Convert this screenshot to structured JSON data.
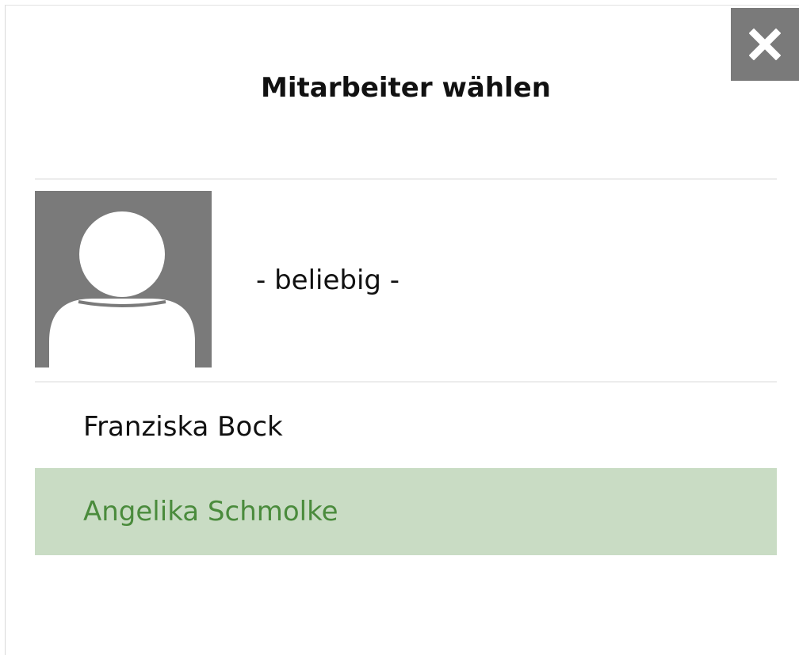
{
  "dialog": {
    "title": "Mitarbeiter wählen",
    "close_icon": "close-icon"
  },
  "options": {
    "any": {
      "label": "- beliebig -",
      "avatar_icon": "person-placeholder-icon"
    },
    "employees": [
      {
        "name": "Franziska Bock",
        "selected": false
      },
      {
        "name": "Angelika Schmolke",
        "selected": true
      }
    ]
  },
  "colors": {
    "selected_background": "#c9dcc4",
    "selected_text": "#4a8b3c",
    "close_button_background": "#7a7a7a",
    "avatar_background": "#7a7a7a"
  }
}
